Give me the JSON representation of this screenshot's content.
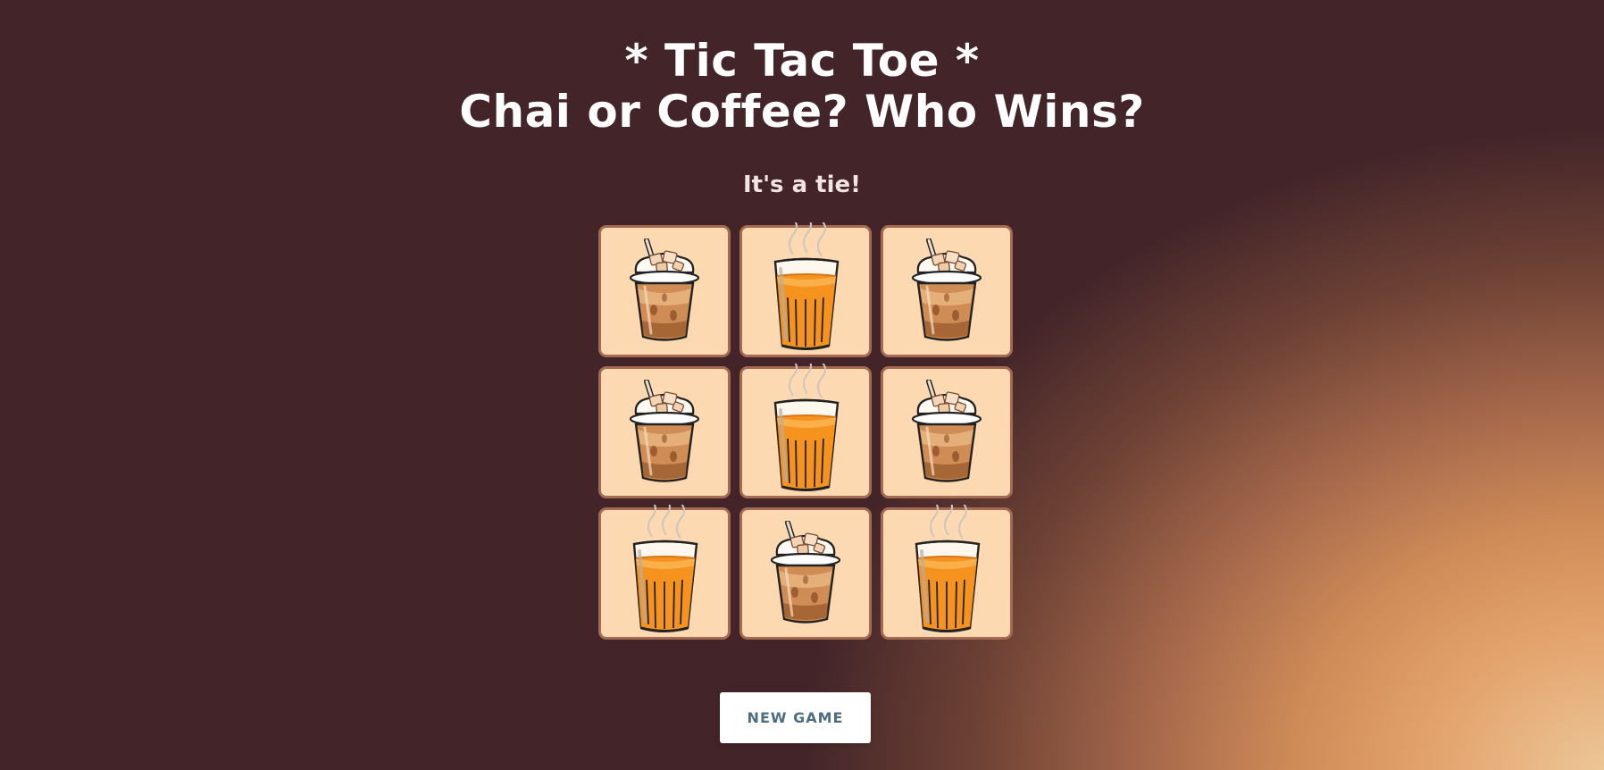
{
  "header": {
    "title_line1": "* Tic Tac Toe *",
    "title_line2": "Chai or Coffee? Who Wins?"
  },
  "status": {
    "text": "It's a tie!"
  },
  "board": {
    "rows": 3,
    "cols": 3,
    "cells": [
      "coffee",
      "chai",
      "coffee",
      "coffee",
      "chai",
      "coffee",
      "chai",
      "coffee",
      "chai"
    ],
    "players": {
      "coffee": {
        "icon": "iced-coffee-icon"
      },
      "chai": {
        "icon": "chai-glass-icon"
      }
    }
  },
  "controls": {
    "new_game_label": "NEW GAME"
  },
  "colors": {
    "background_dark": "#422429",
    "background_glow": "#e3a26c",
    "cell_fill": "#fdd9b1",
    "cell_border": "#a56a52",
    "button_text": "#4e6d80"
  }
}
